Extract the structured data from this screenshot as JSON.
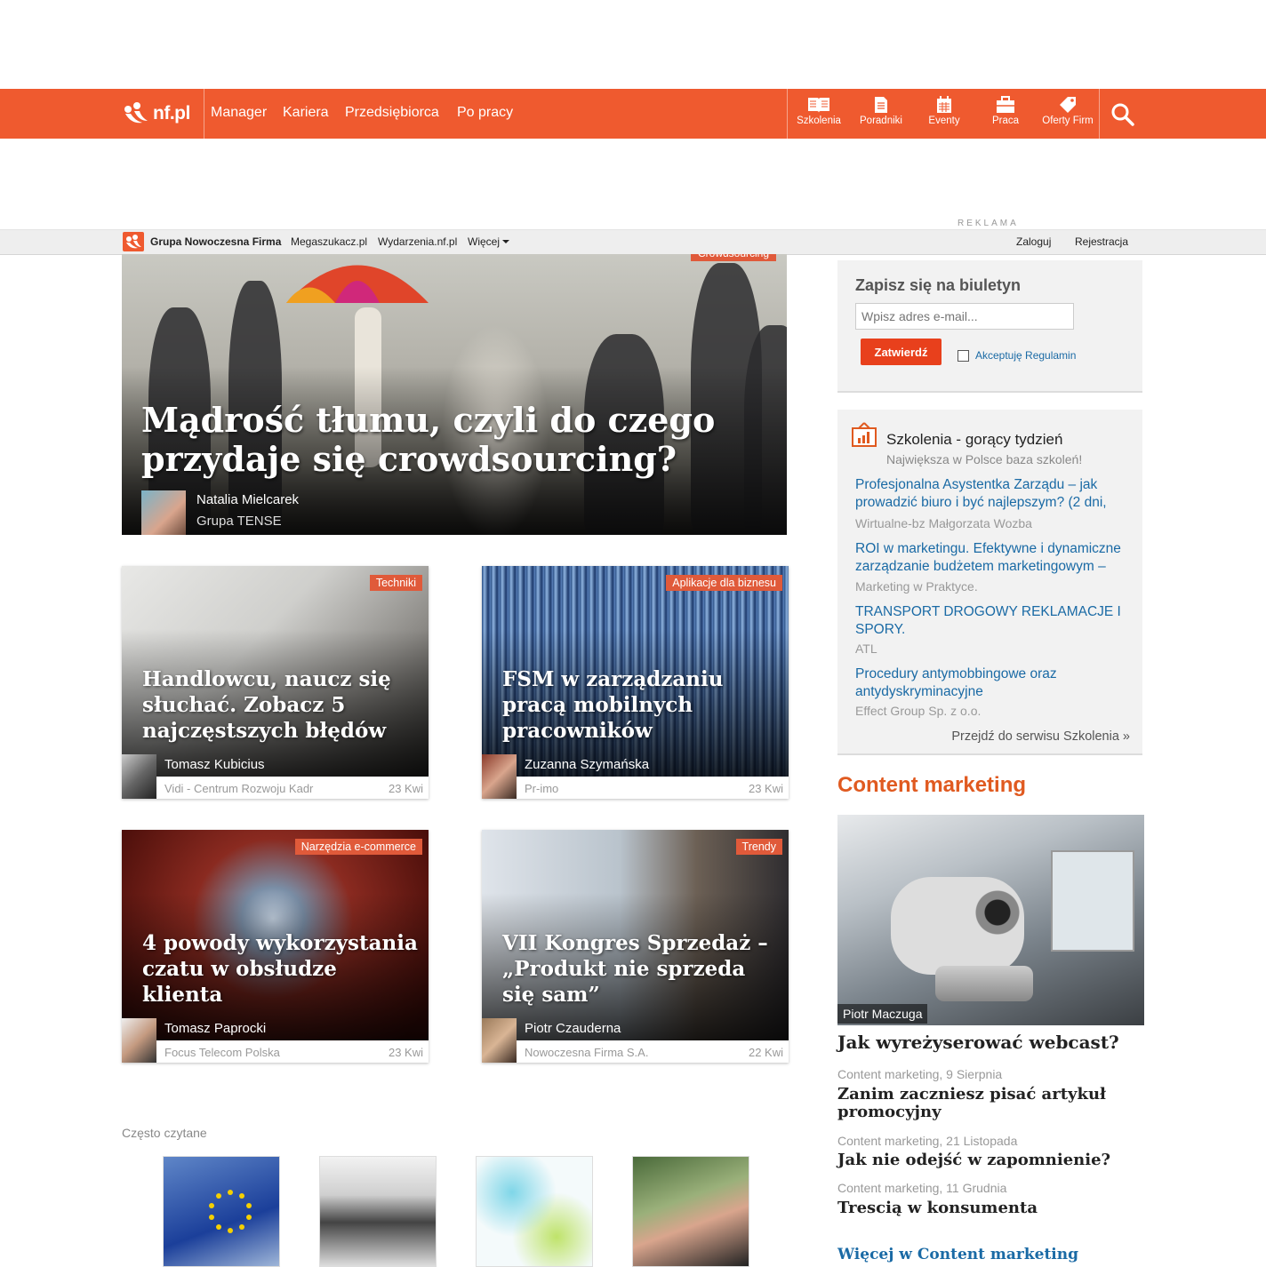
{
  "brand": {
    "logo_text": "nf.pl",
    "accent": "#ef5a2f"
  },
  "nav": {
    "main": [
      "Manager",
      "Kariera",
      "Przedsiębiorca",
      "Po pracy"
    ],
    "services": [
      {
        "label": "Szkolenia",
        "icon": "book-icon"
      },
      {
        "label": "Poradniki",
        "icon": "document-icon"
      },
      {
        "label": "Eventy",
        "icon": "calendar-icon"
      },
      {
        "label": "Praca",
        "icon": "briefcase-icon"
      },
      {
        "label": "Oferty Firm",
        "icon": "tag-icon"
      }
    ]
  },
  "ad_label": "REKLAMA",
  "subbar": {
    "group": "Grupa Nowoczesna Firma",
    "links": [
      "Megaszukacz.pl",
      "Wydarzenia.nf.pl",
      "Więcej"
    ],
    "login": "Zaloguj",
    "register": "Rejestracja"
  },
  "hero": {
    "tag": "Crowdsourcing",
    "title": "Mądrość tłumu, czyli do czego przydaje się crowdsourcing?",
    "author": "Natalia Mielcarek",
    "company": "Grupa TENSE"
  },
  "cards": [
    {
      "tag": "Techniki",
      "title": "Handlowcu, naucz się słuchać. Zobacz 5 najczęstszych błędów",
      "author": "Tomasz Kubicius",
      "company": "Vidi - Centrum Rozwoju Kadr",
      "date": "23 Kwi"
    },
    {
      "tag": "Aplikacje dla biznesu",
      "title": "FSM w zarządzaniu pracą mobilnych pracowników",
      "author": "Zuzanna Szymańska",
      "company": "Pr-imo",
      "date": "23 Kwi"
    },
    {
      "tag": "Narzędzia e-commerce",
      "title": "4 powody wykorzystania czatu w obsłudze klienta",
      "author": "Tomasz Paprocki",
      "company": "Focus Telecom Polska",
      "date": "23 Kwi"
    },
    {
      "tag": "Trendy",
      "title": "VII Kongres Sprzedaż – „Produkt nie sprzeda się sam”",
      "author": "Piotr Czauderna",
      "company": "Nowoczesna Firma S.A.",
      "date": "22 Kwi"
    }
  ],
  "often_read": {
    "label": "Często czytane"
  },
  "newsletter": {
    "title": "Zapisz się na biuletyn",
    "placeholder": "Wpisz adres e-mail...",
    "submit": "Zatwierdź",
    "accept": "Akceptuję Regulamin"
  },
  "szkolenia": {
    "title": "Szkolenia - gorący tydzień",
    "subtitle": "Największa w Polsce baza szkoleń!",
    "items": [
      {
        "title": "Profesjonalna Asystentka Zarządu – jak prowadzić biuro i być najlepszym? (2 dni,",
        "org": "Wirtualne-bz Małgorzata Wozba"
      },
      {
        "title": "ROI w marketingu. Efektywne i dynamiczne zarządzanie budżetem marketingowym –",
        "org": "Marketing w Praktyce."
      },
      {
        "title": "TRANSPORT DROGOWY REKLAMACJE I SPORY.",
        "org": "ATL"
      },
      {
        "title": "Procedury antymobbingowe oraz antydyskryminacyjne",
        "org": "Effect Group Sp. z o.o."
      }
    ],
    "more": "Przejdź do serwisu Szkolenia »"
  },
  "content_marketing": {
    "heading": "Content marketing",
    "image_author": "Piotr Maczuga",
    "main_title": "Jak wyreżyserować webcast?",
    "articles": [
      {
        "meta": "Content marketing, 9 Sierpnia",
        "title": "Zanim zaczniesz pisać artykuł promocyjny"
      },
      {
        "meta": "Content marketing, 21 Listopada",
        "title": "Jak nie odejść w zapomnienie?"
      },
      {
        "meta": "Content marketing, 11 Grudnia",
        "title": "Trescią w konsumenta"
      }
    ],
    "more": "Więcej w Content marketing"
  }
}
